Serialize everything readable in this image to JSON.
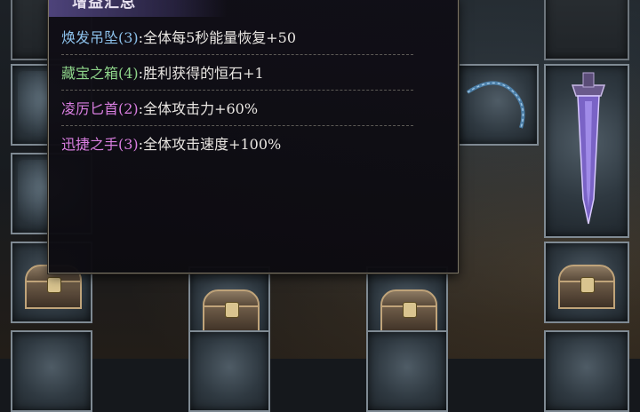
{
  "tooltip": {
    "title": "增益汇总",
    "buffs": [
      {
        "name": "焕发吊坠(3)",
        "desc": ":全体每5秒能量恢复+50",
        "color": "#8cc0ea"
      },
      {
        "name": "藏宝之箱(4)",
        "desc": ":胜利获得的恒石+1",
        "color": "#8ed48a"
      },
      {
        "name": "凌厉匕首(2)",
        "desc": ":全体攻击力+60%",
        "color": "#d97ee0"
      },
      {
        "name": "迅捷之手(3)",
        "desc": ":全体攻击速度+100%",
        "color": "#d97ee0"
      }
    ]
  },
  "inventory": {
    "items": [
      {
        "type": "empty"
      },
      {
        "type": "empty"
      },
      {
        "type": "whip"
      },
      {
        "type": "dagger"
      },
      {
        "type": "frost"
      },
      {
        "type": "chest"
      },
      {
        "type": "chest"
      },
      {
        "type": "chest"
      },
      {
        "type": "chest"
      },
      {
        "type": "chest"
      }
    ]
  }
}
